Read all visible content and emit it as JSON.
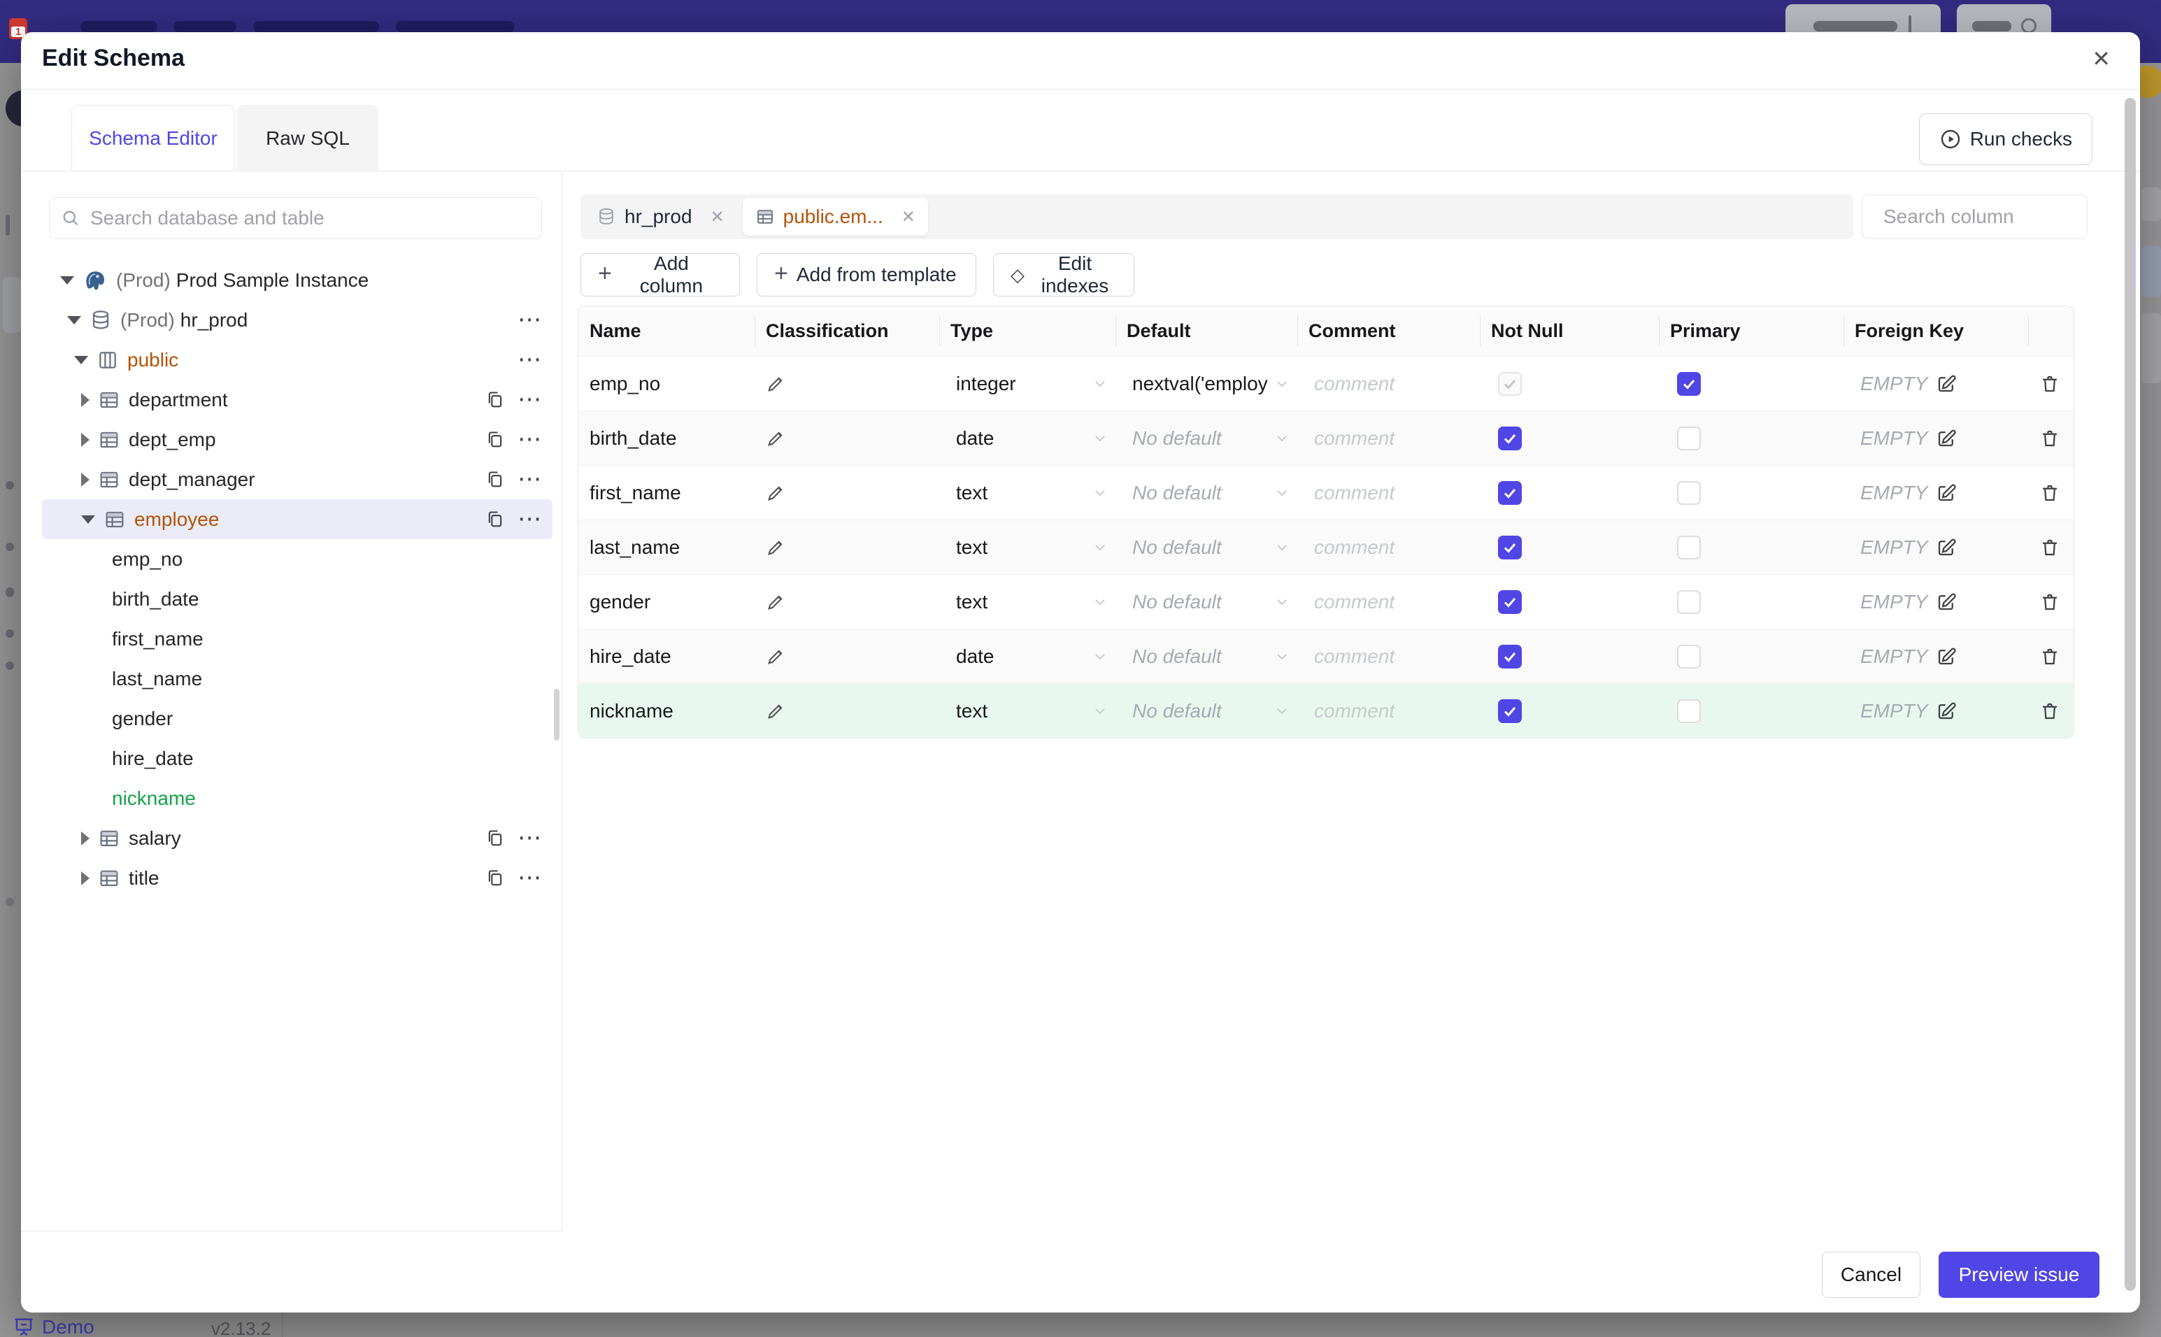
{
  "colors": {
    "navbar": "#322b80",
    "accent": "#5046e5",
    "amber": "#b45309",
    "green": "#16a34a",
    "selected_row": "#ebecf8",
    "new_row_bg": "#e9f8ef"
  },
  "icons": {
    "plus": "+",
    "diamond": "◇",
    "close": "✕",
    "dots": "⋯"
  },
  "navbar": {
    "favicon_badge": "1"
  },
  "modal": {
    "title": "Edit Schema",
    "tabs": [
      {
        "label": "Schema Editor",
        "active": true
      },
      {
        "label": "Raw SQL",
        "active": false
      }
    ],
    "run_checks_label": "Run checks"
  },
  "sidebar": {
    "search_placeholder": "Search database and table",
    "tree": [
      {
        "type": "instance",
        "prefix": "(Prod)",
        "name": "Prod Sample Instance",
        "expanded": true
      },
      {
        "type": "database",
        "prefix": "(Prod)",
        "name": "hr_prod",
        "expanded": true
      },
      {
        "type": "schema",
        "name": "public",
        "status": "modified",
        "expanded": true
      },
      {
        "type": "table",
        "name": "department"
      },
      {
        "type": "table",
        "name": "dept_emp"
      },
      {
        "type": "table",
        "name": "dept_manager"
      },
      {
        "type": "table",
        "name": "employee",
        "status": "modified",
        "selected": true,
        "expanded": true
      },
      {
        "type": "column",
        "name": "emp_no"
      },
      {
        "type": "column",
        "name": "birth_date"
      },
      {
        "type": "column",
        "name": "first_name"
      },
      {
        "type": "column",
        "name": "last_name"
      },
      {
        "type": "column",
        "name": "gender"
      },
      {
        "type": "column",
        "name": "hire_date"
      },
      {
        "type": "column",
        "name": "nickname",
        "status": "created"
      },
      {
        "type": "table",
        "name": "salary"
      },
      {
        "type": "table",
        "name": "title"
      }
    ]
  },
  "editor": {
    "tabs": [
      {
        "label": "hr_prod",
        "icon": "database-icon",
        "active": false
      },
      {
        "label": "public.em...",
        "icon": "table-icon",
        "active": true
      }
    ],
    "search_placeholder": "Search column",
    "toolbar": {
      "add_column": "Add column",
      "add_from_template": "Add from template",
      "edit_indexes": "Edit indexes"
    },
    "table": {
      "headers": [
        "Name",
        "Classification",
        "Type",
        "Default",
        "Comment",
        "Not Null",
        "Primary",
        "Foreign Key"
      ],
      "comment_placeholder": "comment",
      "rows": [
        {
          "name": "emp_no",
          "type": "integer",
          "default": "nextval('employ",
          "default_kind": "value",
          "not_null": "checked-disabled",
          "primary": "checked",
          "foreign_key": "EMPTY"
        },
        {
          "name": "birth_date",
          "type": "date",
          "default": "No default",
          "default_kind": "placeholder",
          "not_null": "checked",
          "primary": "unchecked",
          "foreign_key": "EMPTY"
        },
        {
          "name": "first_name",
          "type": "text",
          "default": "No default",
          "default_kind": "placeholder",
          "not_null": "checked",
          "primary": "unchecked",
          "foreign_key": "EMPTY"
        },
        {
          "name": "last_name",
          "type": "text",
          "default": "No default",
          "default_kind": "placeholder",
          "not_null": "checked",
          "primary": "unchecked",
          "foreign_key": "EMPTY"
        },
        {
          "name": "gender",
          "type": "text",
          "default": "No default",
          "default_kind": "placeholder",
          "not_null": "checked",
          "primary": "unchecked",
          "foreign_key": "EMPTY"
        },
        {
          "name": "hire_date",
          "type": "date",
          "default": "No default",
          "default_kind": "placeholder",
          "not_null": "checked",
          "primary": "unchecked",
          "foreign_key": "EMPTY"
        },
        {
          "name": "nickname",
          "type": "text",
          "default": "No default",
          "default_kind": "placeholder",
          "not_null": "checked",
          "primary": "unchecked",
          "foreign_key": "EMPTY",
          "row_status": "created"
        }
      ]
    }
  },
  "footer": {
    "cancel_label": "Cancel",
    "primary_label": "Preview issue"
  },
  "status_bar": {
    "demo_label": "Demo",
    "version": "v2.13.2"
  }
}
